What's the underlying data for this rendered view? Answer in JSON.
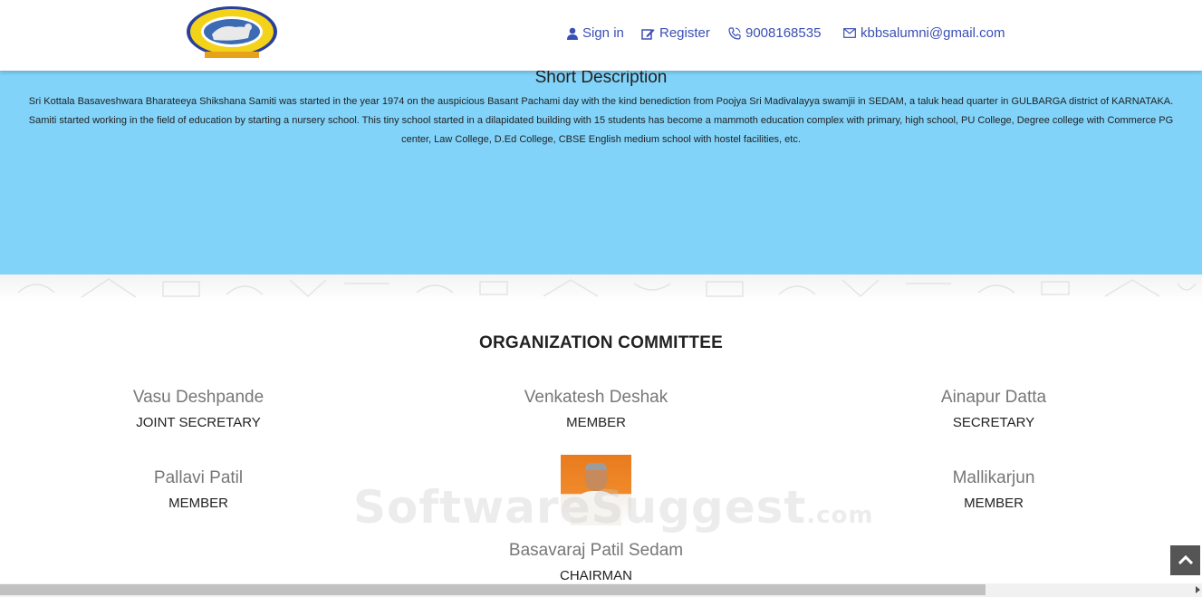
{
  "header": {
    "nav": [
      {
        "icon": "user-icon",
        "label": "Sign in"
      },
      {
        "icon": "edit-icon",
        "label": "Register"
      },
      {
        "icon": "phone-icon",
        "label": "9008168535"
      },
      {
        "icon": "envelope-icon",
        "label": "kbbsalumni@gmail.com"
      }
    ]
  },
  "description": {
    "title": "Short Description",
    "text": "Sri Kottala Basaveshwara Bharateeya Shikshana Samiti was started in the year 1974 on the auspicious Basant Pachami day with the kind benediction from Poojya Sri Madivalayya swamjii in SEDAM, a taluk head quarter in GULBARGA district of KARNATAKA. Samiti started working in the field of education by starting a nursery school. This tiny school started in a dilapidated building with 15 students has become a mammoth education complex with primary, high school, PU College, Degree college with Commerce PG center, Law College, D.Ed College, CBSE English medium school with hostel facilities, etc."
  },
  "committee": {
    "title": "ORGANIZATION COMMITTEE",
    "members": [
      {
        "name": "Vasu Deshpande",
        "role": "JOINT SECRETARY"
      },
      {
        "name": "Venkatesh Deshak",
        "role": "MEMBER"
      },
      {
        "name": "Ainapur Datta",
        "role": "SECRETARY"
      },
      {
        "name": "Pallavi Patil",
        "role": "MEMBER"
      },
      {
        "name": "Mallikarjun",
        "role": "MEMBER"
      },
      {
        "name": "Basavaraj Patil Sedam",
        "role": "CHAIRMAN"
      }
    ]
  },
  "watermark": {
    "main": "SoftwareSuggest",
    "suffix": ".com"
  },
  "colors": {
    "nav_link": "#3a4fb5",
    "description_bg": "#81d3f9",
    "scroll_top_bg": "#555555"
  }
}
